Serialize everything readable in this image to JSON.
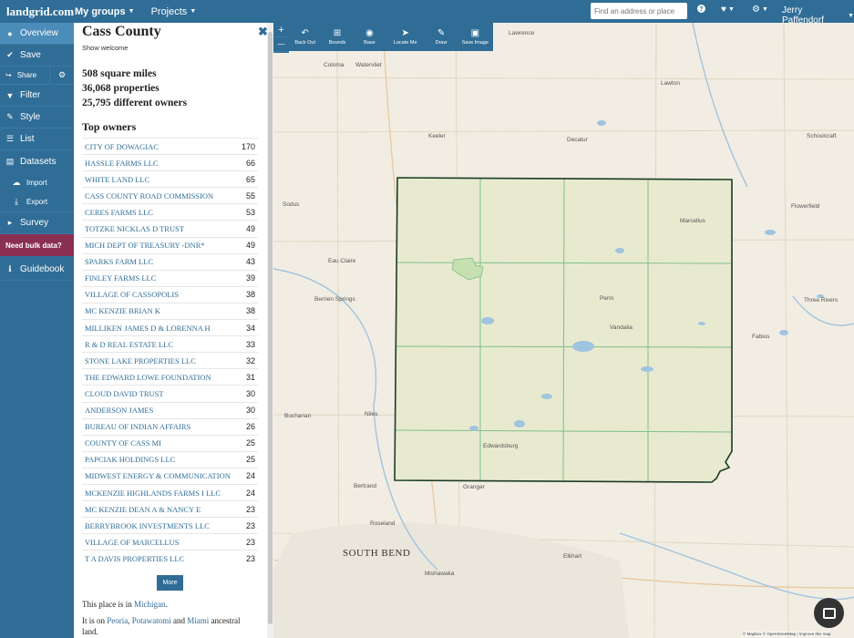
{
  "nav": {
    "brand": "landgrid.com",
    "my_groups": "My groups",
    "projects": "Projects",
    "search_placeholder": "Find an address or place",
    "help_icon": "question-circle-icon",
    "user_name": "Jerry Paffendorf"
  },
  "sidebar": {
    "overview": "Overview",
    "save": "Save",
    "share": "Share",
    "filter": "Filter",
    "style": "Style",
    "list": "List",
    "datasets": "Datasets",
    "import": "Import",
    "export": "Export",
    "survey": "Survey",
    "bulk": "Need bulk data?",
    "guidebook": "Guidebook"
  },
  "panel": {
    "title": "Cass County",
    "show_welcome": "Show welcome",
    "stats": [
      "508 square miles",
      "36,068 properties",
      "25,795 different owners"
    ],
    "top_owners_title": "Top owners",
    "owners": [
      {
        "name": "City of Dowagiac",
        "count": "170"
      },
      {
        "name": "Hassle Farms LLC",
        "count": "66"
      },
      {
        "name": "White Land LLC",
        "count": "65"
      },
      {
        "name": "Cass County Road Commission",
        "count": "55"
      },
      {
        "name": "Ceres Farms LLC",
        "count": "53"
      },
      {
        "name": "Totzke Nicklas D Trust",
        "count": "49"
      },
      {
        "name": "Mich Dept of Treasury -DNR*",
        "count": "49"
      },
      {
        "name": "Sparks Farm LLC",
        "count": "43"
      },
      {
        "name": "Finley Farms LLC",
        "count": "39"
      },
      {
        "name": "Village of Cassopolis",
        "count": "38"
      },
      {
        "name": "Mc Kenzie Brian K",
        "count": "38"
      },
      {
        "name": "Milliken James D & Lorenna H",
        "count": "34"
      },
      {
        "name": "R & D Real Estate LLC",
        "count": "33"
      },
      {
        "name": "Stone Lake Properties LLC",
        "count": "32"
      },
      {
        "name": "The Edward Lowe Foundation",
        "count": "31"
      },
      {
        "name": "Cloud David Trust",
        "count": "30"
      },
      {
        "name": "Anderson James",
        "count": "30"
      },
      {
        "name": "Bureau of Indian Affairs",
        "count": "26"
      },
      {
        "name": "County of Cass MI",
        "count": "25"
      },
      {
        "name": "Papciak Holdings LLC",
        "count": "25"
      },
      {
        "name": "Midwest Energy & Communication",
        "count": "24"
      },
      {
        "name": "McKenzie Highlands Farms I LLC",
        "count": "24"
      },
      {
        "name": "Mc Kenzie Dean A & Nancy E",
        "count": "23"
      },
      {
        "name": "Berrybrook Investments LLC",
        "count": "23"
      },
      {
        "name": "Village of Marcellus",
        "count": "23"
      },
      {
        "name": "T A Davis Properties LLC",
        "count": "23"
      }
    ],
    "more": "More",
    "place_prefix": "This place is in ",
    "place_state": "Michigan",
    "place_suffix": ".",
    "ancestral_prefix": "It is on ",
    "nation_1": "Peoria",
    "sep_1": ", ",
    "nation_2": "Potawatomi",
    "sep_2": " and ",
    "nation_3": "Miami",
    "ancestral_suffix": " ancestral land."
  },
  "map_tools": {
    "zoom_in": "+",
    "zoom_out": "—",
    "back_out": "Back Out",
    "bounds": "Bounds",
    "base": "Base",
    "locate_me": "Locate Me",
    "draw": "Draw",
    "save_image": "Save Image"
  },
  "map_labels": {
    "lawrence": "Lawrence",
    "coloma": "Coloma",
    "watervliet": "Watervliet",
    "lawton": "Lawton",
    "keeler": "Keeler",
    "decatur": "Decatur",
    "schoolcraft": "Schoolcraft",
    "sodus": "Sodus",
    "flowerfield": "Flowerfield",
    "marcellus": "Marcellus",
    "eau_claire": "Eau Claire",
    "berrien_springs": "Berrien Springs",
    "penn": "Penn",
    "three_rivers": "Three Rivers",
    "vandalia": "Vandalia",
    "fabius": "Fabius",
    "buchanan": "Buchanan",
    "niles": "Niles",
    "edwardsburg": "Edwardsburg",
    "bertrand": "Bertrand",
    "granger": "Granger",
    "roseland": "Roseland",
    "south_bend": "SOUTH BEND",
    "mishawaka": "Mishawaka",
    "elkhart": "Elkhart"
  },
  "attribution": "© Mapbox © OpenStreetMap | Improve this map",
  "colors": {
    "brand_blue": "#2f6d96",
    "bulk_purple": "#8a2e52",
    "boundary": "#1a3d24",
    "township_lines": "#7cc08a",
    "water": "#9fc4df",
    "county_fill": "#e8ead0"
  }
}
